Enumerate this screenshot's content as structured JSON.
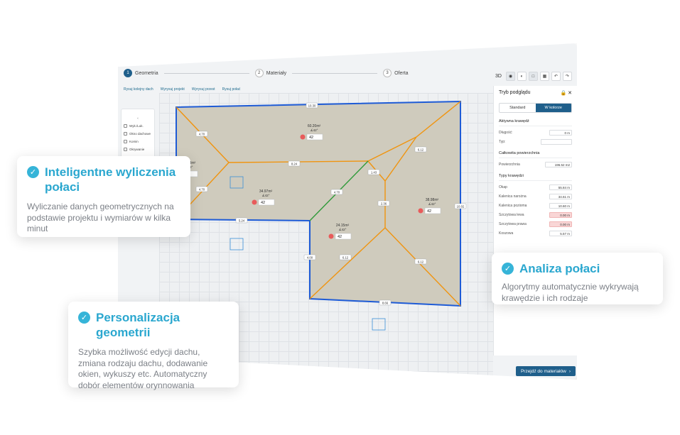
{
  "stepper": {
    "steps": [
      {
        "num": "1",
        "label": "Geometria"
      },
      {
        "num": "2",
        "label": "Materiały"
      },
      {
        "num": "3",
        "label": "Oferta"
      }
    ]
  },
  "toolbar": {
    "view_3d": "3D"
  },
  "tabs": [
    "Rysuj kolejny dach",
    "Wyrysuj projekt",
    "Wyrysuj przest",
    "Rysuj połać"
  ],
  "left_panel": {
    "items": [
      "Wyk./Luk.",
      "Okno dachowe",
      "Komin",
      "Okrywanie"
    ]
  },
  "right_panel": {
    "title": "Tryb podglądu",
    "toggle_standard": "Standard",
    "toggle_color": "W kolorze",
    "active_edge": "Aktywna krawędź",
    "length_label": "Długość:",
    "length_value": "0 m",
    "type_label": "Typ:",
    "total_area": "Całkowita powierzchnia",
    "area_label": "Powierzchnia",
    "area_value": "196.52 m2",
    "edge_types": "Typy krawędzi",
    "edges": [
      {
        "label": "Okap",
        "value": "55.84 m",
        "red": false
      },
      {
        "label": "Kalenica narożna",
        "value": "34.61 m",
        "red": false
      },
      {
        "label": "Kalenica pozioma",
        "value": "10.60 m",
        "red": false
      },
      {
        "label": "Szczytowa lewa",
        "value": "0.00 m",
        "red": true
      },
      {
        "label": "Szczytowa prawa",
        "value": "0.00 m",
        "red": true
      },
      {
        "label": "Koszowa",
        "value": "5.57 m",
        "red": false
      }
    ]
  },
  "canvas": {
    "dims": [
      "10.30",
      "4.70",
      "4.70",
      "6.12",
      "8.24",
      "1.43",
      "4.70",
      "2.36",
      "10.02",
      "5.24",
      "4.00",
      "6.12",
      "6.12",
      "8.66"
    ],
    "areas": [
      {
        "area": "60.20m²",
        "angle": "∡42°",
        "slope": "42"
      },
      {
        "area": "34.83m²",
        "angle": "∡42°",
        "slope": "42"
      },
      {
        "area": "34.97m²",
        "angle": "∡42°",
        "slope": "42"
      },
      {
        "area": "38.98m²",
        "angle": "∡42°",
        "slope": "42"
      },
      {
        "area": "24.15m²",
        "angle": "∡42°",
        "slope": "42"
      }
    ]
  },
  "next_button": "Przejdź do materiałów",
  "cards": [
    {
      "title": "Inteligentne wyliczenia połaci",
      "text": "Wyliczanie danych geometrycznych na podstawie projektu i wymiarów w kilka minut"
    },
    {
      "title": "Personalizacja geometrii",
      "text": "Szybka możliwość edycji dachu, zmiana rodzaju dachu, dodawanie okien, wykuszy etc. Automatyczny dobór elementów orynnowania"
    },
    {
      "title": "Analiza połaci",
      "text": "Algorytmy automatycznie wykrywają krawędzie i ich rodzaje"
    }
  ],
  "colors": {
    "accent": "#2aa7cf",
    "brand": "#1f5f8b",
    "eave": "#1e5bd6",
    "hip": "#f0940f",
    "valley": "#2f9a3a",
    "roof_fill": "#cfcbbd"
  }
}
